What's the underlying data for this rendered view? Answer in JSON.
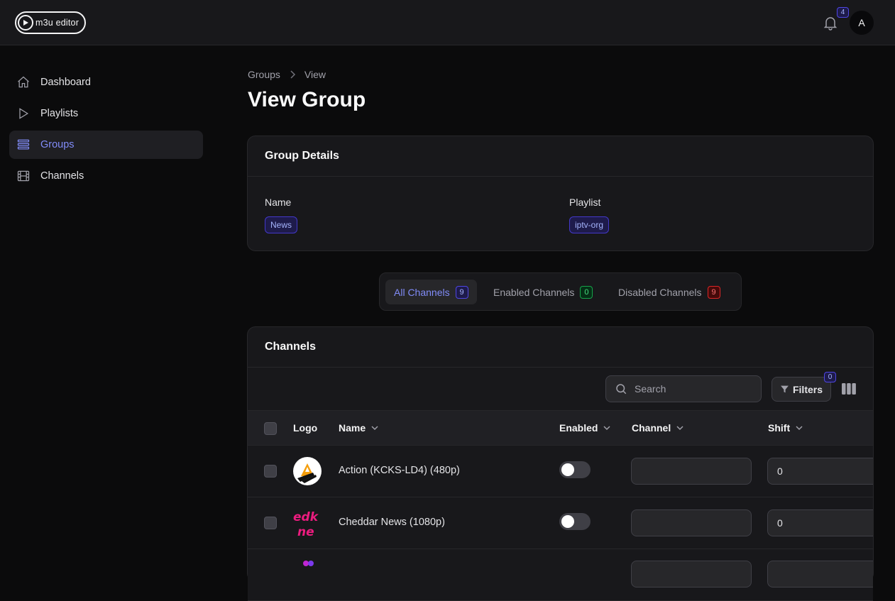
{
  "app": {
    "logo_text": "m3u editor"
  },
  "header": {
    "notification_count": "4",
    "avatar_initial": "A"
  },
  "sidebar": {
    "items": [
      {
        "label": "Dashboard",
        "icon": "home-icon"
      },
      {
        "label": "Playlists",
        "icon": "play-icon"
      },
      {
        "label": "Groups",
        "icon": "list-icon",
        "active": true
      },
      {
        "label": "Channels",
        "icon": "film-icon"
      }
    ]
  },
  "breadcrumb": {
    "parent": "Groups",
    "current": "View"
  },
  "page": {
    "title": "View Group"
  },
  "group_details": {
    "heading": "Group Details",
    "name_label": "Name",
    "name_value": "News",
    "playlist_label": "Playlist",
    "playlist_value": "iptv-org"
  },
  "tabs": [
    {
      "label": "All Channels",
      "count": "9",
      "color": "blue",
      "active": true
    },
    {
      "label": "Enabled Channels",
      "count": "0",
      "color": "green"
    },
    {
      "label": "Disabled Channels",
      "count": "9",
      "color": "red"
    }
  ],
  "channels_table": {
    "heading": "Channels",
    "search_placeholder": "Search",
    "filters_label": "Filters",
    "filters_count": "0",
    "columns": {
      "logo": "Logo",
      "name": "Name",
      "enabled": "Enabled",
      "channel": "Channel",
      "shift": "Shift"
    },
    "rows": [
      {
        "name": "Action (KCKS-LD4) (480p)",
        "enabled": false,
        "channel": "",
        "shift": "0",
        "logo": "action-logo"
      },
      {
        "name": "Cheddar News (1080p)",
        "enabled": false,
        "channel": "",
        "shift": "0",
        "logo": "cheddar-logo"
      }
    ]
  },
  "colors": {
    "accent": "#818cf8",
    "background": "#0b0b0c",
    "surface": "#18181b"
  }
}
